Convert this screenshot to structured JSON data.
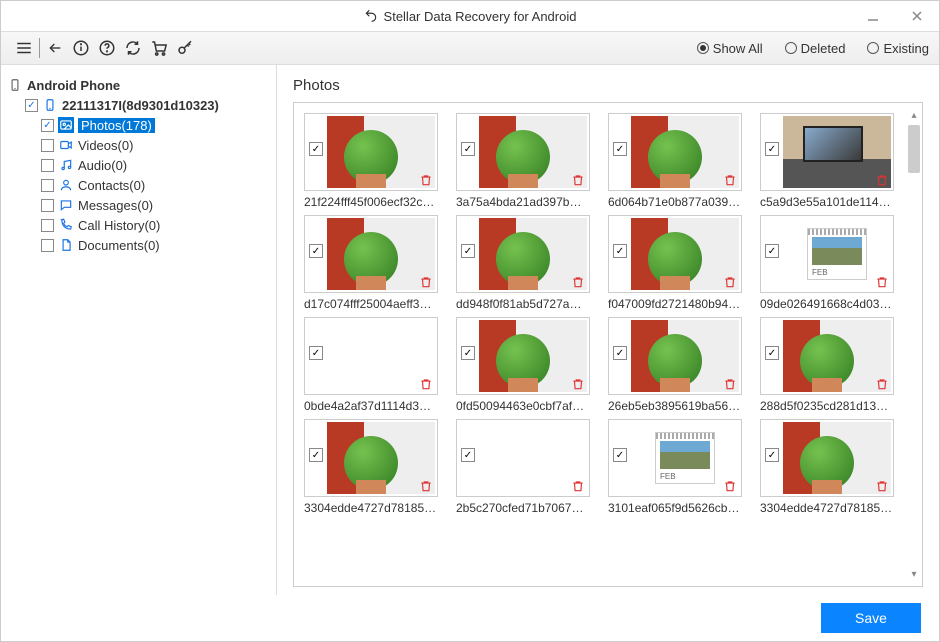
{
  "app": {
    "title": "Stellar Data Recovery for Android"
  },
  "toolbar": {
    "filter": {
      "show_all": "Show All",
      "deleted": "Deleted",
      "existing": "Existing",
      "selected": "show_all"
    }
  },
  "sidebar": {
    "root": "Android Phone",
    "device": "22111317I(8d9301d10323)",
    "items": [
      {
        "id": "photos",
        "label": "Photos(178)",
        "checked": true,
        "selected": true
      },
      {
        "id": "videos",
        "label": "Videos(0)",
        "checked": false,
        "selected": false
      },
      {
        "id": "audio",
        "label": "Audio(0)",
        "checked": false,
        "selected": false
      },
      {
        "id": "contacts",
        "label": "Contacts(0)",
        "checked": false,
        "selected": false
      },
      {
        "id": "messages",
        "label": "Messages(0)",
        "checked": false,
        "selected": false
      },
      {
        "id": "callhist",
        "label": "Call History(0)",
        "checked": false,
        "selected": false
      },
      {
        "id": "docs",
        "label": "Documents(0)",
        "checked": false,
        "selected": false
      }
    ]
  },
  "main": {
    "section_title": "Photos",
    "photos": [
      {
        "name": "21f224fff45f006ecf32c…",
        "kind": "plant"
      },
      {
        "name": "3a75a4bda21ad397b…",
        "kind": "plant"
      },
      {
        "name": "6d064b71e0b877a039…",
        "kind": "plant"
      },
      {
        "name": "c5a9d3e55a101de114…",
        "kind": "desk"
      },
      {
        "name": "d17c074fff25004aeff3…",
        "kind": "plant"
      },
      {
        "name": "dd948f0f81ab5d727a…",
        "kind": "plant"
      },
      {
        "name": "f047009fd2721480b94…",
        "kind": "plant"
      },
      {
        "name": "09de026491668c4d03…",
        "kind": "calendar"
      },
      {
        "name": "0bde4a2af37d1114d3…",
        "kind": "blank"
      },
      {
        "name": "0fd50094463e0cbf7af…",
        "kind": "plant"
      },
      {
        "name": "26eb5eb3895619ba56…",
        "kind": "plant"
      },
      {
        "name": "288d5f0235cd281d13…",
        "kind": "plant"
      },
      {
        "name": "3304edde4727d78185…",
        "kind": "plant"
      },
      {
        "name": "2b5c270cfed71b7067…",
        "kind": "blank"
      },
      {
        "name": "3101eaf065f9d5626cb…",
        "kind": "calendar"
      },
      {
        "name": "3304edde4727d78185…",
        "kind": "plant"
      }
    ]
  },
  "footer": {
    "save_label": "Save"
  },
  "icons": {
    "photos": "#1a73e8",
    "videos": "#1a73e8",
    "audio": "#1a73e8",
    "contacts": "#1a73e8",
    "messages": "#1a73e8",
    "callhist": "#1a73e8",
    "docs": "#1a73e8"
  }
}
